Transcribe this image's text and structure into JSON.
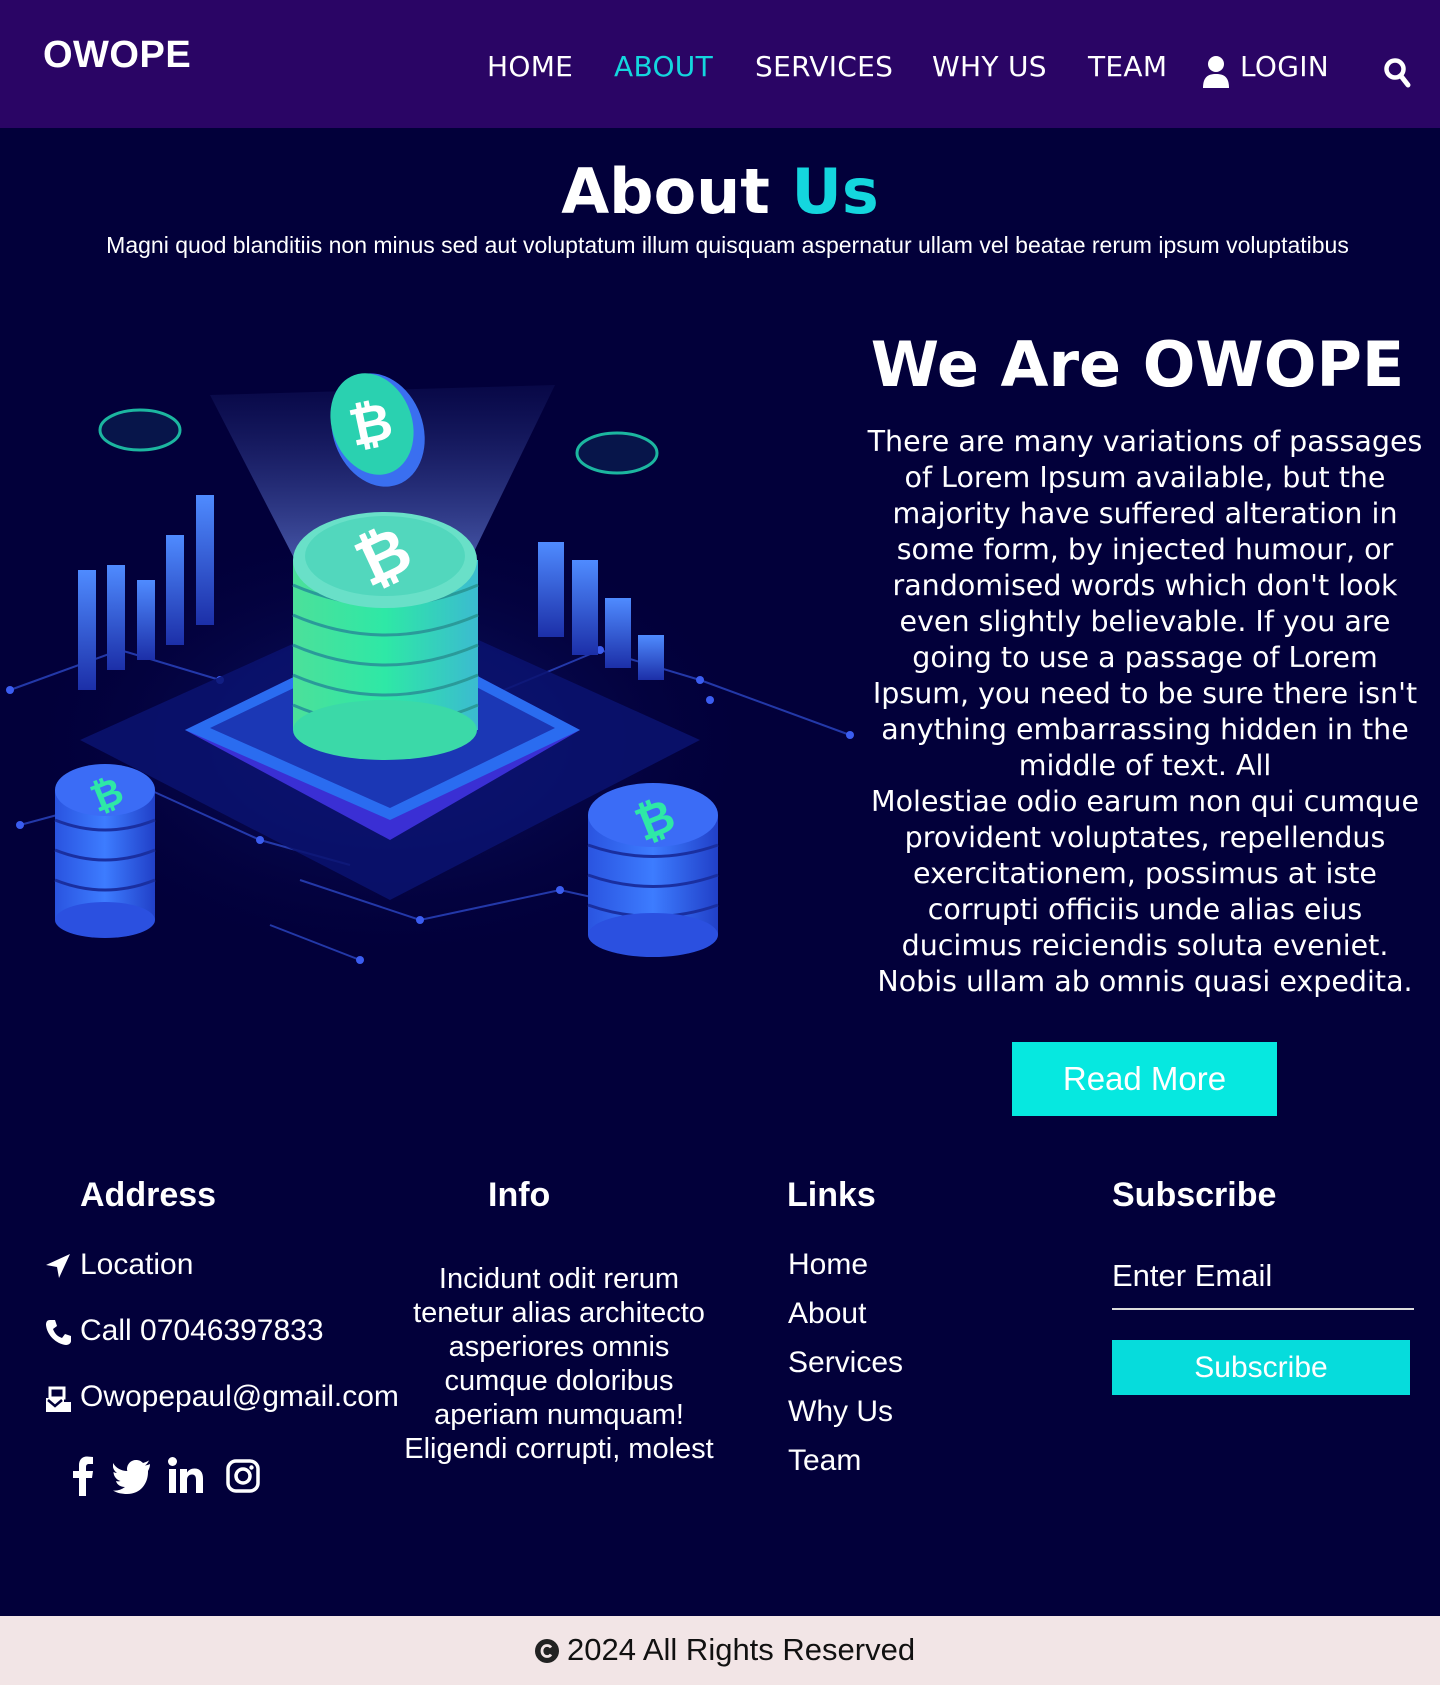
{
  "header": {
    "logo": "OWOPE",
    "nav": [
      "HOME",
      "ABOUT",
      "SERVICES",
      "WHY US",
      "TEAM"
    ],
    "login": "LOGIN"
  },
  "about": {
    "title_plain": "About ",
    "title_accent": "Us",
    "subtitle": "Magni quod blanditiis non minus sed aut voluptatum illum quisquam aspernatur ullam vel beatae rerum ipsum voluptatibus"
  },
  "hero": {
    "heading": "We Are OWOPE",
    "lines": [
      "There are many variations of passages",
      "of Lorem Ipsum available, but the",
      "majority have suffered alteration in",
      "some form, by injected humour, or",
      "randomised words which don't look",
      "even slightly believable. If you are",
      "going to use a passage of Lorem",
      "Ipsum, you need to be sure there isn't",
      "anything embarrassing hidden in the",
      "middle of text. All",
      "Molestiae odio earum non qui cumque",
      "provident voluptates, repellendus",
      "exercitationem, possimus at iste",
      "corrupti officiis unde alias eius",
      "ducimus reiciendis soluta eveniet.",
      "Nobis ullam ab omnis quasi expedita."
    ],
    "read_more": "Read More"
  },
  "footer": {
    "address_heading": "Address",
    "location": "Location",
    "phone": "Call 07046397833",
    "email": "Owopepaul@gmail.com",
    "info_heading": "Info",
    "info_lines": [
      "Incidunt odit rerum",
      "tenetur alias architecto",
      "asperiores omnis",
      "cumque doloribus",
      "aperiam numquam!",
      "Eligendi corrupti, molest"
    ],
    "links_heading": "Links",
    "links": [
      "Home",
      "About",
      "Services",
      "Why Us",
      "Team"
    ],
    "subscribe_heading": "Subscribe",
    "email_placeholder": "Enter Email",
    "subscribe_button": "Subscribe",
    "social": [
      "facebook-icon",
      "twitter-icon",
      "linkedin-icon",
      "instagram-icon"
    ]
  },
  "copyright": "2024 All Rights Reserved",
  "colors": {
    "page_bg": "#02003a",
    "header_bg": "#2a0565",
    "accent": "#14d6de",
    "button": "#06e8e0",
    "copyright_bg": "#f2e5e6"
  }
}
